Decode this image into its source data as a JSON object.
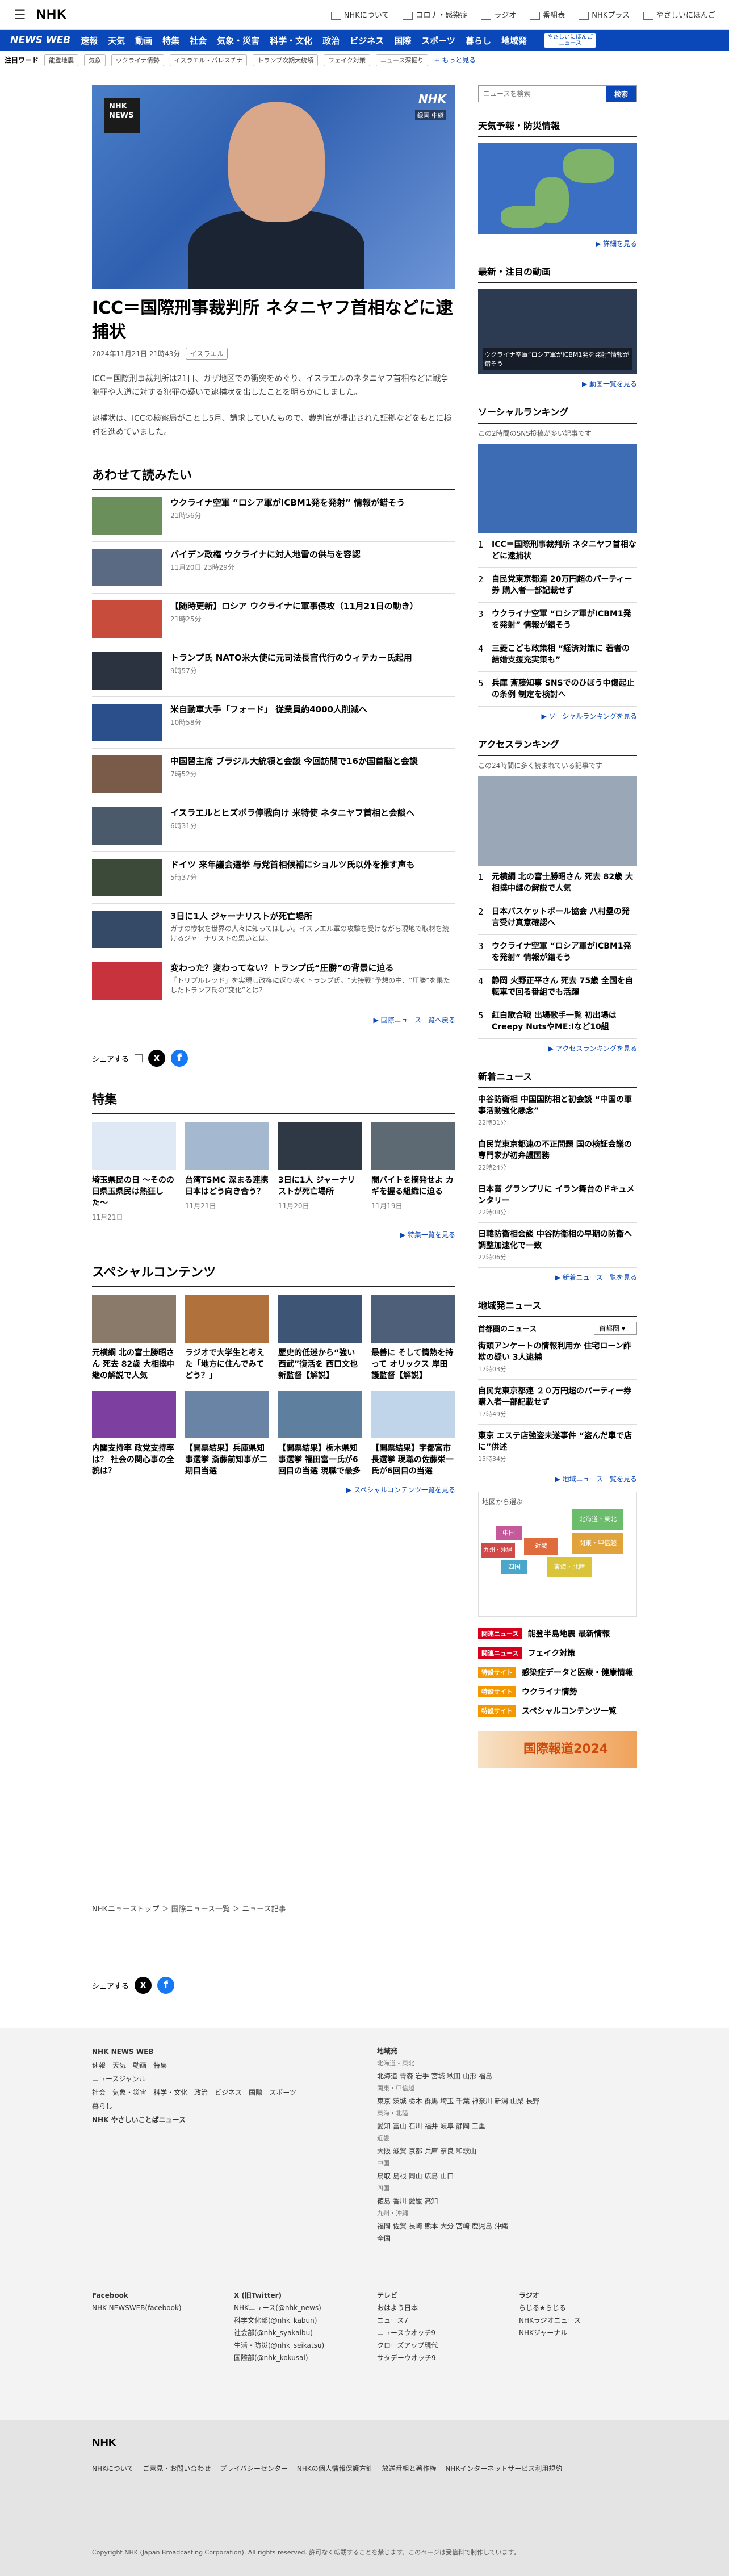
{
  "header": {
    "logo": "NHK",
    "links": [
      "NHKについて",
      "コロナ・感染症",
      "ラジオ",
      "番組表",
      "NHKプラス",
      "やさしいにほんご"
    ]
  },
  "nav": {
    "brand": "NEWS WEB",
    "items": [
      "速報",
      "天気",
      "動画",
      "特集",
      "社会",
      "気象・災害",
      "科学・文化",
      "政治",
      "ビジネス",
      "国際",
      "スポーツ",
      "暮らし",
      "地域発"
    ],
    "nl": "やさしいにほんご\nニュース"
  },
  "keywords": {
    "label": "注目ワード",
    "tags": [
      "能登地震",
      "気象",
      "ウクライナ情勢",
      "イスラエル・パレスチナ",
      "トランプ次期大統領",
      "フェイク対策",
      "ニュース深掘り"
    ],
    "more": "もっと見る"
  },
  "hero": {
    "badge": "録画 中継",
    "nhk": "NHK NEWS"
  },
  "article": {
    "title": "ICC＝国際刑事裁判所 ネタニヤフ首相などに逮捕状",
    "date": "2024年11月21日 21時43分",
    "tag": "イスラエル",
    "p1": "ICC＝国際刑事裁判所は21日、ガザ地区での衝突をめぐり、イスラエルのネタニヤフ首相などに戦争犯罪や人道に対する犯罪の疑いで逮捕状を出したことを明らかにしました。",
    "p2": "逮捕状は、ICCの検察局がことし5月、請求していたもので、裁判官が提出された証拠などをもとに検討を進めていました。"
  },
  "related": {
    "title": "あわせて読みたい",
    "items": [
      {
        "t": "ウクライナ空軍 “ロシア軍がICBM1発を発射” 情報が錯そう",
        "d": "21時56分"
      },
      {
        "t": "バイデン政権 ウクライナに対人地雷の供与を容認",
        "d": "11月20日 23時29分"
      },
      {
        "t": "【随時更新】ロシア ウクライナに軍事侵攻（11月21日の動き）",
        "d": "21時25分"
      },
      {
        "t": "トランプ氏 NATO米大使に元司法長官代行のウィテカー氏起用",
        "d": "9時57分"
      },
      {
        "t": "米自動車大手「フォード」 従業員約4000人削減へ",
        "d": "10時58分"
      },
      {
        "t": "中国習主席 ブラジル大統領と会談 今回訪問で16か国首脳と会談",
        "d": "7時52分"
      },
      {
        "t": "イスラエルとヒズボラ停戦向け 米特使 ネタニヤフ首相と会談へ",
        "d": "6時31分"
      },
      {
        "t": "ドイツ 来年議会選挙 与党首相候補にショルツ氏以外を推す声も",
        "d": "5時37分"
      },
      {
        "t": "3日に1人 ジャーナリストが死亡場所",
        "d": "",
        "s": "ガザの惨状を世界の人々に知ってほしい。イスラエル軍の攻撃を受けながら現地で取材を続けるジャーナリストの思いとは。"
      },
      {
        "t": "変わった？変わってない？トランプ氏“圧勝”の背景に迫る",
        "d": "",
        "s": "「トリプルレッド」を実現し政権に返り咲くトランプ氏。“大接戦”予想の中、“圧勝”を果たしたトランプ氏の“変化”とは？"
      }
    ],
    "more": "国際ニュース一覧へ戻る"
  },
  "share": {
    "label": "シェアする"
  },
  "features": {
    "title": "特集",
    "items": [
      {
        "t": "埼玉県民の日 〜そのの日県玉県民は熱狂した〜",
        "d": "11月21日"
      },
      {
        "t": "台湾TSMC 深まる連携 日本はどう向き合う？",
        "d": "11月21日"
      },
      {
        "t": "3日に1人 ジャーナリストが死亡場所",
        "d": "11月20日"
      },
      {
        "t": "闇バイトを摘発せよ カギを握る組織に迫る",
        "d": "11月19日"
      }
    ],
    "more": "特集一覧を見る"
  },
  "special": {
    "title": "スペシャルコンテンツ",
    "items": [
      {
        "t": "元横綱 北の富士勝昭さん 死去 82歳 大相撲中継の解説で人気"
      },
      {
        "t": "ラジオで大学生と考えた「地方に住んでみてどう？」"
      },
      {
        "t": "歴史的低迷から“強い西武”復活を 西口文也新監督【解説】"
      },
      {
        "t": "最善に そして情熱を持って オリックス 岸田護監督【解説】"
      },
      {
        "t": "内閣支持率 政党支持率は？ 社会の関心事の全貌は？"
      },
      {
        "t": "【開票結果】兵庫県知事選挙 斎藤前知事が二期目当選"
      },
      {
        "t": "【開票結果】栃木県知事選挙 福田富一氏が6回目の当選 現職で最多"
      },
      {
        "t": "【開票結果】宇都宮市長選挙 現職の佐藤栄一氏が6回目の当選"
      }
    ],
    "more": "スペシャルコンテンツ一覧を見る"
  },
  "side": {
    "search": {
      "placeholder": "ニュースを検索",
      "button": "検索"
    },
    "weather": {
      "title": "天気予報・防災情報",
      "more": "詳細を見る"
    },
    "video": {
      "title": "最新・注目の動画",
      "caption": "ウクライナ空軍“ロシア軍がICBM1発を発射”情報が錯そう",
      "more": "動画一覧を見る"
    },
    "social": {
      "title": "ソーシャルランキング",
      "note": "この2時間のSNS投稿が多い記事です",
      "items": [
        "ICC＝国際刑事裁判所 ネタニヤフ首相などに逮捕状",
        "自民党東京都連 20万円超のパーティー券 購入者一部記載せず",
        "ウクライナ空軍 “ロシア軍がICBM1発を発射” 情報が錯そう",
        "三菱こども政策相 “経済対策に 若者の結婚支援充実策も”",
        "兵庫 斎藤知事 SNSでのひぼう中傷起止の条例 制定を検討へ"
      ],
      "more": "ソーシャルランキングを見る"
    },
    "access": {
      "title": "アクセスランキング",
      "note": "この24時間に多く読まれている記事です",
      "items": [
        "元横綱 北の富士勝昭さん 死去 82歳 大相撲中継の解説で人気",
        "日本バスケットボール協会 八村塁の発言受け真意確認へ",
        "ウクライナ空軍 “ロシア軍がICBM1発を発射” 情報が錯そう",
        "静岡 火野正平さん 死去 75歳 全国を自転車で回る番組でも活躍",
        "紅白歌合戦 出場歌手一覧 初出場は Creepy NutsやME:Iなど10組"
      ],
      "more": "アクセスランキングを見る"
    },
    "news": {
      "title": "新着ニュース",
      "items": [
        {
          "t": "中谷防衛相 中国国防相と初会談 “中国の軍事活動強化懸念”",
          "d": "22時31分"
        },
        {
          "t": "自民党東京都連の不正問題 国の検証会議の専門家が初弁護国務",
          "d": "22時24分"
        },
        {
          "t": "日本賞 グランプリに イラン舞台のドキュメンタリー",
          "d": "22時08分"
        },
        {
          "t": "日韓防衛相会談 中谷防衛相の早期の防衛へ調整加速化で一致",
          "d": "22時06分"
        }
      ],
      "more": "新着ニュース一覧を見る"
    },
    "region": {
      "title": "地域発ニュース",
      "label": "首都圏のニュース",
      "select": "首都圏",
      "items": [
        {
          "t": "街頭アンケートの情報利用か 住宅ローン詐欺の疑い 3人逮捕",
          "d": "17時03分"
        },
        {
          "t": "自民党東京都連 ２０万円超のパーティー券購入者一部記載せず",
          "d": "17時49分"
        },
        {
          "t": "東京 エステ店強盗未遂事件 “盗んだ車で店に”供述",
          "d": "15時34分"
        }
      ],
      "more": "地域ニュース一覧を見る",
      "mapnote": "地図から選ぶ",
      "areas": [
        "北海道・東北",
        "関東・甲信越",
        "東海・北陸",
        "近畿",
        "中国",
        "四国",
        "九州・沖縄"
      ]
    },
    "banners": [
      {
        "l": "関連ニュース",
        "t": "能登半島地震 最新情報"
      },
      {
        "l": "関連ニュース",
        "t": "フェイク対策"
      },
      {
        "l": "特設サイト",
        "t": "感染症データと医療・健康情報"
      },
      {
        "l": "特設サイト",
        "t": "ウクライナ情勢"
      },
      {
        "l": "特設サイト",
        "t": "スペシャルコンテンツ一覧"
      }
    ],
    "promo": "国際報道2024"
  },
  "breadcrumb": [
    "NHKニューストップ",
    "国際ニュース一覧",
    "ニュース記事"
  ],
  "footer": {
    "col1": {
      "h": "NHK NEWS WEB",
      "items": [
        "速報",
        "天気",
        "動画",
        "特集",
        "ニュースジャンル",
        "社会",
        "気象・災害",
        "科学・文化",
        "政治",
        "ビジネス",
        "国際",
        "スポーツ",
        "暮らし",
        "NHK やさしいことばニュース"
      ]
    },
    "col2": {
      "h": "地域発",
      "items": [
        "北海道・東北",
        "北海道 青森 岩手 宮城 秋田 山形 福島",
        "関東・甲信越",
        "東京 茨城 栃木 群馬 埼玉 千葉 神奈川 新潟 山梨 長野",
        "東海・北陸",
        "愛知 富山 石川 福井 岐阜 静岡 三重",
        "近畿",
        "大阪 滋賀 京都 兵庫 奈良 和歌山",
        "中国",
        "鳥取 島根 岡山 広島 山口",
        "四国",
        "徳島 香川 愛媛 高知",
        "九州・沖縄",
        "福岡 佐賀 長崎 熊本 大分 宮崎 鹿児島 沖縄",
        "全国"
      ]
    },
    "sns": {
      "facebook": [
        "Facebook",
        "NHK NEWSWEB(facebook)"
      ],
      "x": [
        "X (旧Twitter)",
        "NHKニュース(@nhk_news)",
        "科学文化部(@nhk_kabun)",
        "社会部(@nhk_syakaibu)",
        "生活・防災(@nhk_seikatsu)",
        "国際部(@nhk_kokusai)"
      ],
      "tv": [
        "テレビ",
        "おはよう日本",
        "ニュース7",
        "ニュースウオッチ9",
        "クローズアップ現代",
        "サタデーウオッチ9"
      ],
      "radio": [
        "ラジオ",
        "らじる★らじる",
        "NHKラジオニュース",
        "NHKジャーナル"
      ]
    },
    "legal": {
      "links": [
        "NHKについて",
        "ご意見・お問い合わせ",
        "プライバシーセンター",
        "NHKの個人情報保護方針",
        "放送番組と著作権",
        "NHKインターネットサービス利用規約"
      ],
      "copyright": "Copyright NHK (Japan Broadcasting Corporation). All rights reserved. 許可なく転載することを禁じます。このページは受信料で制作しています。"
    }
  }
}
